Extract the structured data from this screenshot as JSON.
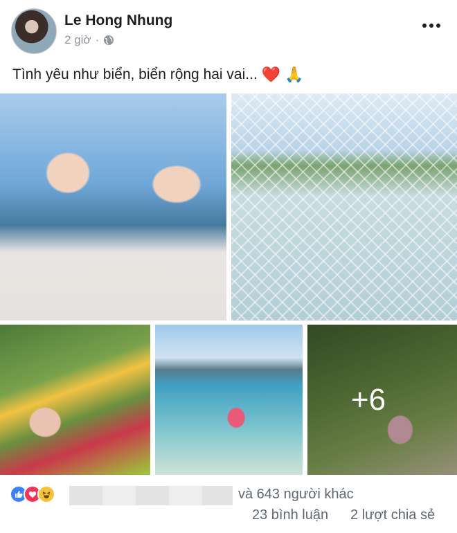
{
  "post": {
    "author": "Le Hong Nhung",
    "time": "2 giờ",
    "separator": "·",
    "privacy_icon": "globe-icon",
    "caption": "Tình yêu như biển, biển rộng hai vai...",
    "caption_emojis": [
      "❤️",
      "🙏"
    ]
  },
  "photos": {
    "more_count_label": "+6"
  },
  "footer": {
    "reaction_icons": [
      "like-icon",
      "love-icon",
      "haha-icon"
    ],
    "others_text": "và 643 người khác",
    "comments_text": "23 bình luận",
    "shares_text": "2 lượt chia sẻ"
  },
  "colors": {
    "meta_text": "#90949c",
    "footer_text": "#616770",
    "like_blue": "#3b82f6",
    "love_red": "#f0355b"
  }
}
